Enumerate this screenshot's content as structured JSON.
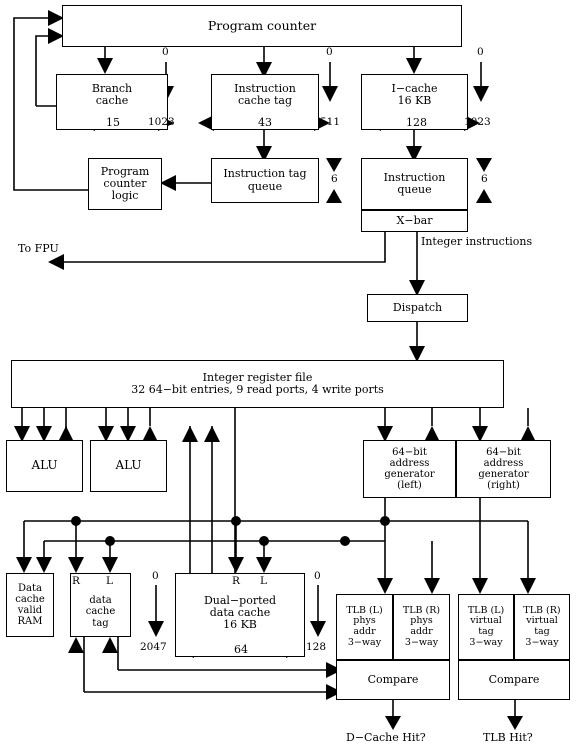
{
  "title": "Superscalar processor instruction and data path block diagram",
  "blocks": {
    "program_counter": "Program counter",
    "branch_cache": [
      "Branch",
      "cache"
    ],
    "instruction_cache_tag": [
      "Instruction",
      "cache tag"
    ],
    "icache": [
      "I−cache",
      "16 KB"
    ],
    "pc_logic": [
      "Program",
      "counter",
      "logic"
    ],
    "instruction_tag_queue": [
      "Instruction tag",
      "queue"
    ],
    "instruction_queue": [
      "Instruction",
      "queue"
    ],
    "xbar": "X−bar",
    "dispatch": "Dispatch",
    "register_file": [
      "Integer register file",
      "32 64−bit entries, 9 read ports, 4 write ports"
    ],
    "alu_left": "ALU",
    "alu_right": "ALU",
    "addr_gen_left": [
      "64−bit",
      "address",
      "generator",
      "(left)"
    ],
    "addr_gen_right": [
      "64−bit",
      "address",
      "generator",
      "(right)"
    ],
    "dcache_valid_ram": [
      "Data",
      "cache",
      "valid",
      "RAM"
    ],
    "dcache_tag": [
      "data",
      "cache",
      "tag"
    ],
    "dcache_tag_ports": {
      "r": "R",
      "l": "L"
    },
    "dual_ported_dcache": [
      "Dual−ported",
      "data cache",
      "16 KB"
    ],
    "dual_ported_ports": {
      "r": "R",
      "l": "L"
    },
    "tlb_phys_left": [
      "TLB (L)",
      "phys",
      "addr",
      "3−way"
    ],
    "tlb_phys_right": [
      "TLB (R)",
      "phys",
      "addr",
      "3−way"
    ],
    "tlb_virt_left": [
      "TLB (L)",
      "virtual",
      "tag",
      "3−way"
    ],
    "tlb_virt_right": [
      "TLB (R)",
      "virtual",
      "tag",
      "3−way"
    ],
    "compare_left": "Compare",
    "compare_right": "Compare"
  },
  "labels": {
    "to_fpu": [
      "To",
      "FPU"
    ],
    "integer_instructions": [
      "Integer",
      "instructions"
    ],
    "dcache_hit": "D−Cache Hit?",
    "tlb_hit": "TLB Hit?"
  },
  "index_ranges": {
    "branch_cache": {
      "top": "0",
      "bottom": "1023"
    },
    "instruction_cache_tag": {
      "top": "0",
      "bottom": "511"
    },
    "icache": {
      "top": "0",
      "bottom": "1023"
    },
    "dual_ported_dcache_left": {
      "top": "0",
      "bottom": "2047"
    },
    "dual_ported_dcache_right": {
      "top": "0",
      "bottom": "128"
    }
  },
  "widths": {
    "branch_cache": "15",
    "instruction_cache_tag": "43",
    "icache": "128",
    "dual_ported_dcache": "64"
  },
  "queue_depths": {
    "instruction_tag_queue": "6",
    "instruction_queue": "6"
  },
  "colors": {
    "line": "#000000",
    "background": "#ffffff"
  }
}
